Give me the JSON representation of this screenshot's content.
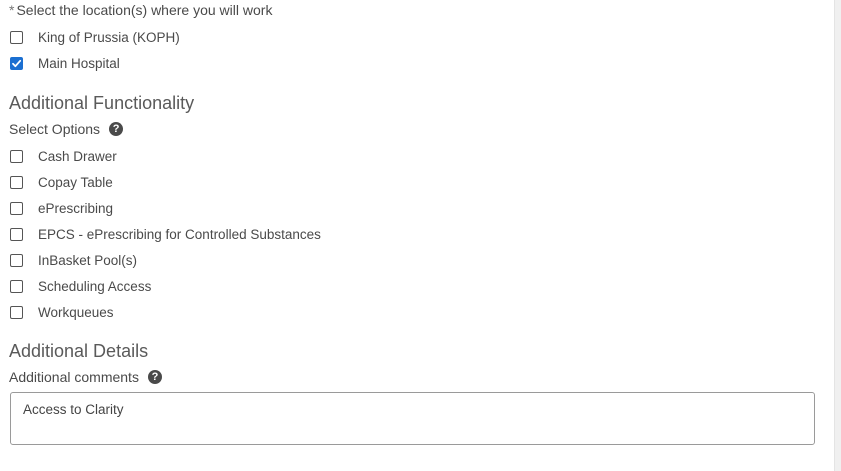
{
  "locations": {
    "required_marker": "*",
    "label": "Select the location(s) where you will work",
    "options": [
      {
        "label": "King of Prussia (KOPH)",
        "checked": false
      },
      {
        "label": "Main Hospital",
        "checked": true
      }
    ]
  },
  "functionality": {
    "title": "Additional Functionality",
    "select_label": "Select Options",
    "help_icon": "question-circle-icon",
    "options": [
      {
        "label": "Cash Drawer",
        "checked": false
      },
      {
        "label": "Copay Table",
        "checked": false
      },
      {
        "label": "ePrescribing",
        "checked": false
      },
      {
        "label": "EPCS - ePrescribing for Controlled Substances",
        "checked": false
      },
      {
        "label": "InBasket Pool(s)",
        "checked": false
      },
      {
        "label": "Scheduling Access",
        "checked": false
      },
      {
        "label": "Workqueues",
        "checked": false
      }
    ]
  },
  "details": {
    "title": "Additional Details",
    "comments_label": "Additional comments",
    "help_icon": "question-circle-icon",
    "comments_value": "Access to Clarity"
  },
  "colors": {
    "checkbox_checked": "#1b6fd1",
    "text": "#4a4a4a"
  }
}
